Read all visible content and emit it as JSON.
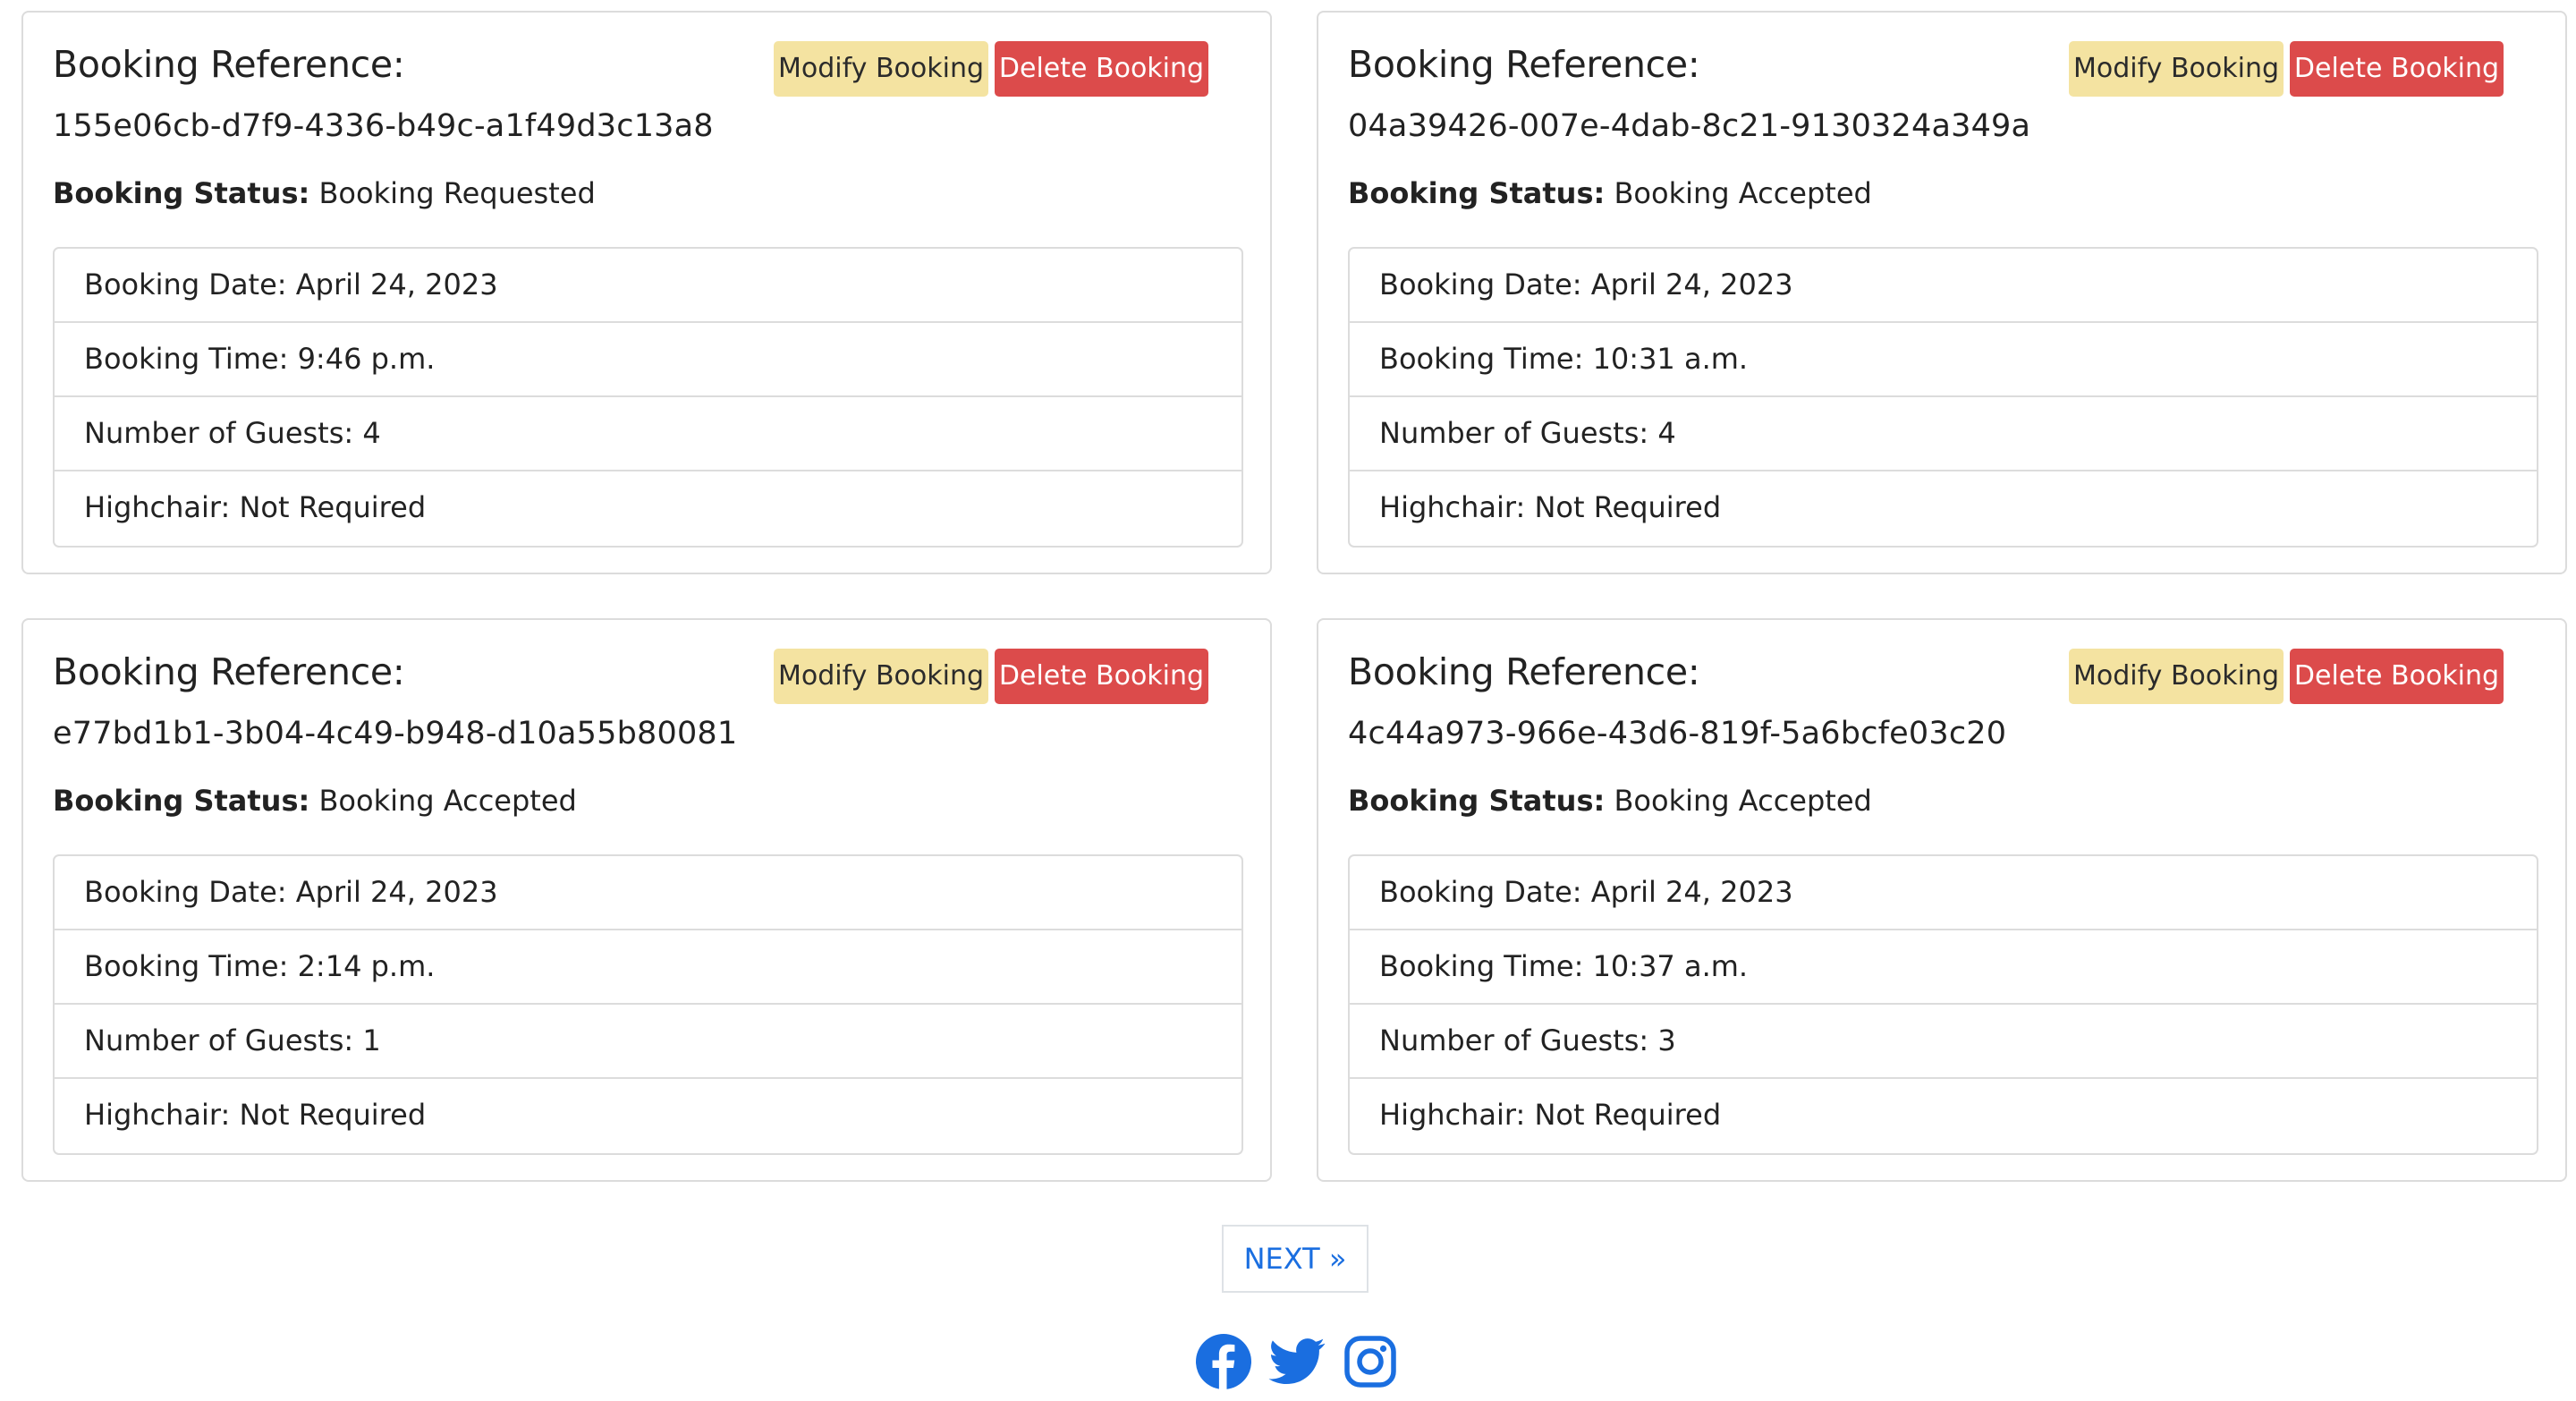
{
  "bookings": [
    {
      "ref_label": "Booking Reference:",
      "ref_value": "155e06cb-d7f9-4336-b49c-a1f49d3c13a8",
      "modify_label": "Modify Booking",
      "delete_label": "Delete Booking",
      "status_label": "Booking Status:",
      "status_value": "Booking Requested",
      "details": [
        "Booking Date: April 24, 2023",
        "Booking Time: 9:46 p.m.",
        "Number of Guests: 4",
        "Highchair: Not Required"
      ]
    },
    {
      "ref_label": "Booking Reference:",
      "ref_value": "04a39426-007e-4dab-8c21-9130324a349a",
      "modify_label": "Modify Booking",
      "delete_label": "Delete Booking",
      "status_label": "Booking Status:",
      "status_value": "Booking Accepted",
      "details": [
        "Booking Date: April 24, 2023",
        "Booking Time: 10:31 a.m.",
        "Number of Guests: 4",
        "Highchair: Not Required"
      ]
    },
    {
      "ref_label": "Booking Reference:",
      "ref_value": "e77bd1b1-3b04-4c49-b948-d10a55b80081",
      "modify_label": "Modify Booking",
      "delete_label": "Delete Booking",
      "status_label": "Booking Status:",
      "status_value": "Booking Accepted",
      "details": [
        "Booking Date: April 24, 2023",
        "Booking Time: 2:14 p.m.",
        "Number of Guests: 1",
        "Highchair: Not Required"
      ]
    },
    {
      "ref_label": "Booking Reference:",
      "ref_value": "4c44a973-966e-43d6-819f-5a6bcfe03c20",
      "modify_label": "Modify Booking",
      "delete_label": "Delete Booking",
      "status_label": "Booking Status:",
      "status_value": "Booking Accepted",
      "details": [
        "Booking Date: April 24, 2023",
        "Booking Time: 10:37 a.m.",
        "Number of Guests: 3",
        "Highchair: Not Required"
      ]
    }
  ],
  "pagination": {
    "next_label": "NEXT »"
  },
  "social": {
    "icons": [
      "facebook-icon",
      "twitter-icon",
      "instagram-icon"
    ],
    "color": "#1a6ee0"
  },
  "colors": {
    "modify_button": "#f4e3a1",
    "delete_button": "#dc4b4b",
    "link": "#1a6ee0",
    "border": "#dcdcdc"
  }
}
